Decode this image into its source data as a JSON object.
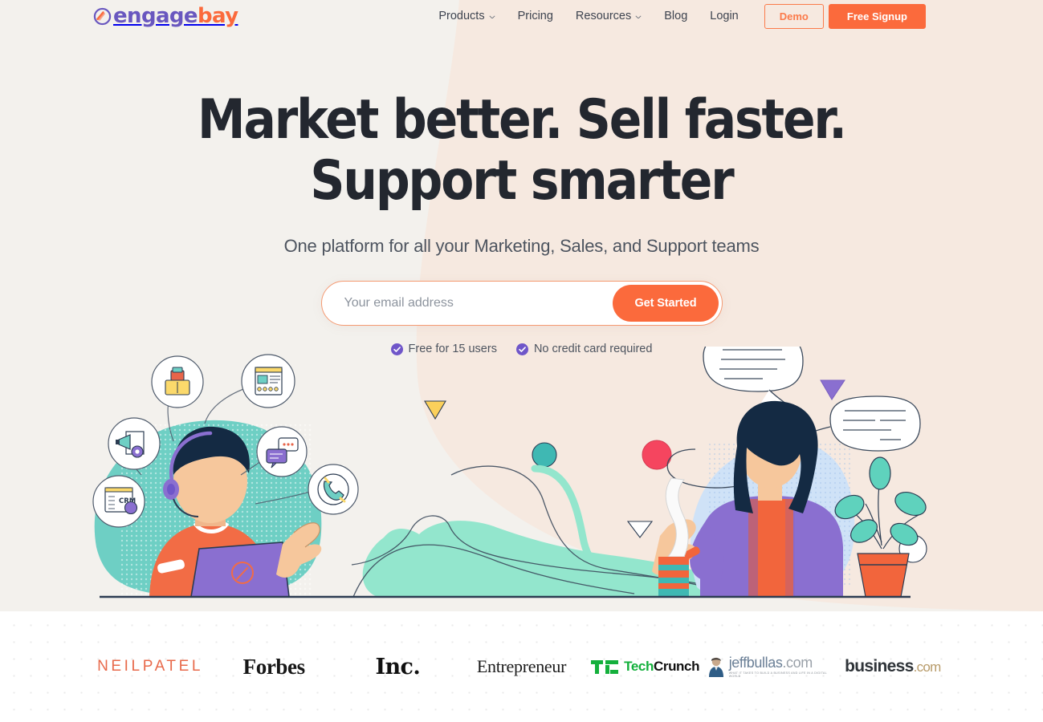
{
  "brand": {
    "logo_text_primary": "engage",
    "logo_text_accent": "bay",
    "logo_icon": "engagebay-check-mark-icon",
    "color_purple": "#6957bf",
    "color_orange": "#fb6a3c"
  },
  "nav": {
    "items": [
      {
        "label": "Products",
        "has_dropdown": true,
        "icon": "chevron-down-icon"
      },
      {
        "label": "Pricing",
        "has_dropdown": false,
        "icon": ""
      },
      {
        "label": "Resources",
        "has_dropdown": true,
        "icon": "chevron-down-icon"
      },
      {
        "label": "Blog",
        "has_dropdown": false,
        "icon": ""
      },
      {
        "label": "Login",
        "has_dropdown": false,
        "icon": ""
      }
    ],
    "demo_label": "Demo",
    "signup_label": "Free Signup"
  },
  "hero": {
    "headline_line1": "Market better. Sell faster.",
    "headline_line2": "Support smarter",
    "subheadline": "One platform for all your Marketing, Sales, and Support teams",
    "email_placeholder": "Your email address",
    "email_value": "",
    "cta_label": "Get Started",
    "assurances": [
      {
        "text": "Free for 15 users",
        "icon": "check-circle-icon"
      },
      {
        "text": "No credit card required",
        "icon": "check-circle-icon"
      }
    ],
    "bg_color_left": "#f3f1ed",
    "bg_color_right": "#f6e9e0"
  },
  "illustration": {
    "left_scene": "support-agent-with-headset-and-laptop",
    "left_bubbles": [
      "office-desk-icon",
      "landing-page-icon",
      "marketing-megaphone-icon",
      "crm-dashboard-icon",
      "live-chat-icon",
      "phone-call-icon"
    ],
    "crm_badge_text": "CRM",
    "right_scene": "woman-with-speech-bubbles-and-plant",
    "decor": [
      "yellow-triangle",
      "teal-circle",
      "red-circle",
      "purple-triangle",
      "white-outline-triangle",
      "white-circle",
      "mint-blob"
    ]
  },
  "logos": {
    "items": [
      {
        "name": "neilpatel",
        "text": "NEILPATEL",
        "accent": ""
      },
      {
        "name": "forbes",
        "text": "Forbes",
        "accent": ""
      },
      {
        "name": "inc",
        "text": "Inc.",
        "accent": ""
      },
      {
        "name": "entrepreneur",
        "text": "Entrepreneur",
        "accent": ""
      },
      {
        "name": "techcrunch",
        "text": "Tech",
        "accent": "Crunch"
      },
      {
        "name": "jeffbullas",
        "text": "jeffbullas",
        "accent": ".com",
        "tagline": "WHAT IT TAKES TO BUILD A BUSINESS AND LIFE IN A DIGITAL WORLD"
      },
      {
        "name": "businesscom",
        "text": "business",
        "accent": ".com"
      }
    ]
  }
}
